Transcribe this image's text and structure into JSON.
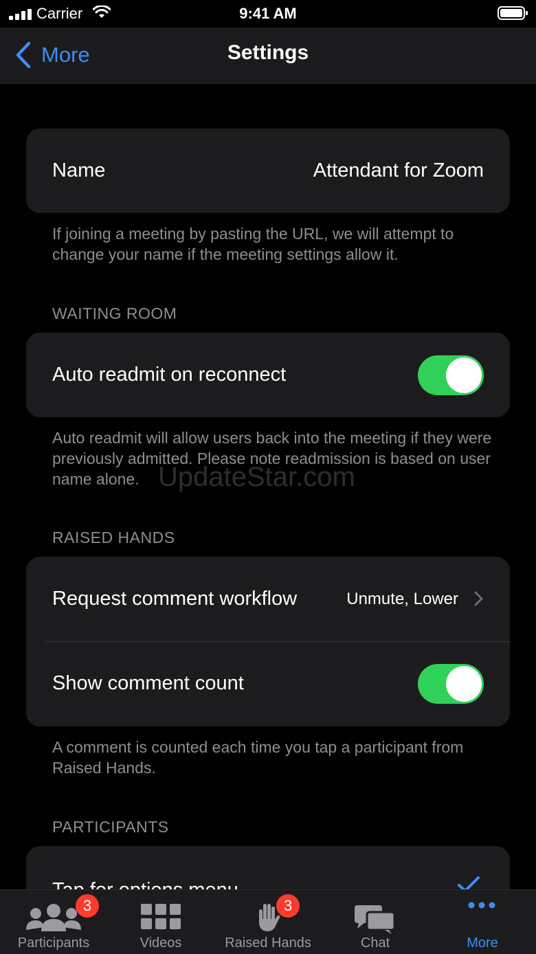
{
  "status": {
    "carrier": "Carrier",
    "time": "9:41 AM"
  },
  "nav": {
    "back_label": "More",
    "title": "Settings"
  },
  "name_row": {
    "label": "Name",
    "value": "Attendant for Zoom"
  },
  "name_footer": "If joining a meeting by pasting the URL, we will attempt to change your name if the meeting settings allow it.",
  "waiting_room": {
    "header": "WAITING ROOM",
    "auto_readmit_label": "Auto readmit on reconnect",
    "auto_readmit_on": true,
    "footer": "Auto readmit will allow users back into the meeting if they were previously admitted. Please note readmission is based on user name alone."
  },
  "watermark": "UpdateStar.com",
  "raised_hands": {
    "header": "RAISED HANDS",
    "request_label": "Request comment workflow",
    "request_value": "Unmute, Lower",
    "show_count_label": "Show comment count",
    "show_count_on": true,
    "footer": "A comment is counted each time you tap a participant from Raised Hands."
  },
  "participants": {
    "header": "PARTICIPANTS",
    "tap_options_label": "Tap for options menu"
  },
  "tabs": [
    {
      "label": "Participants",
      "icon": "participants-icon",
      "badge": "3"
    },
    {
      "label": "Videos",
      "icon": "videos-grid-icon"
    },
    {
      "label": "Raised Hands",
      "icon": "raised-hand-icon",
      "badge": "3"
    },
    {
      "label": "Chat",
      "icon": "chat-icon"
    },
    {
      "label": "More",
      "icon": "more-dots-icon",
      "active": true
    }
  ],
  "colors": {
    "accent": "#3d8ef0",
    "toggle_on": "#30d158",
    "badge": "#ff3b30",
    "cell": "#1c1c1e"
  }
}
